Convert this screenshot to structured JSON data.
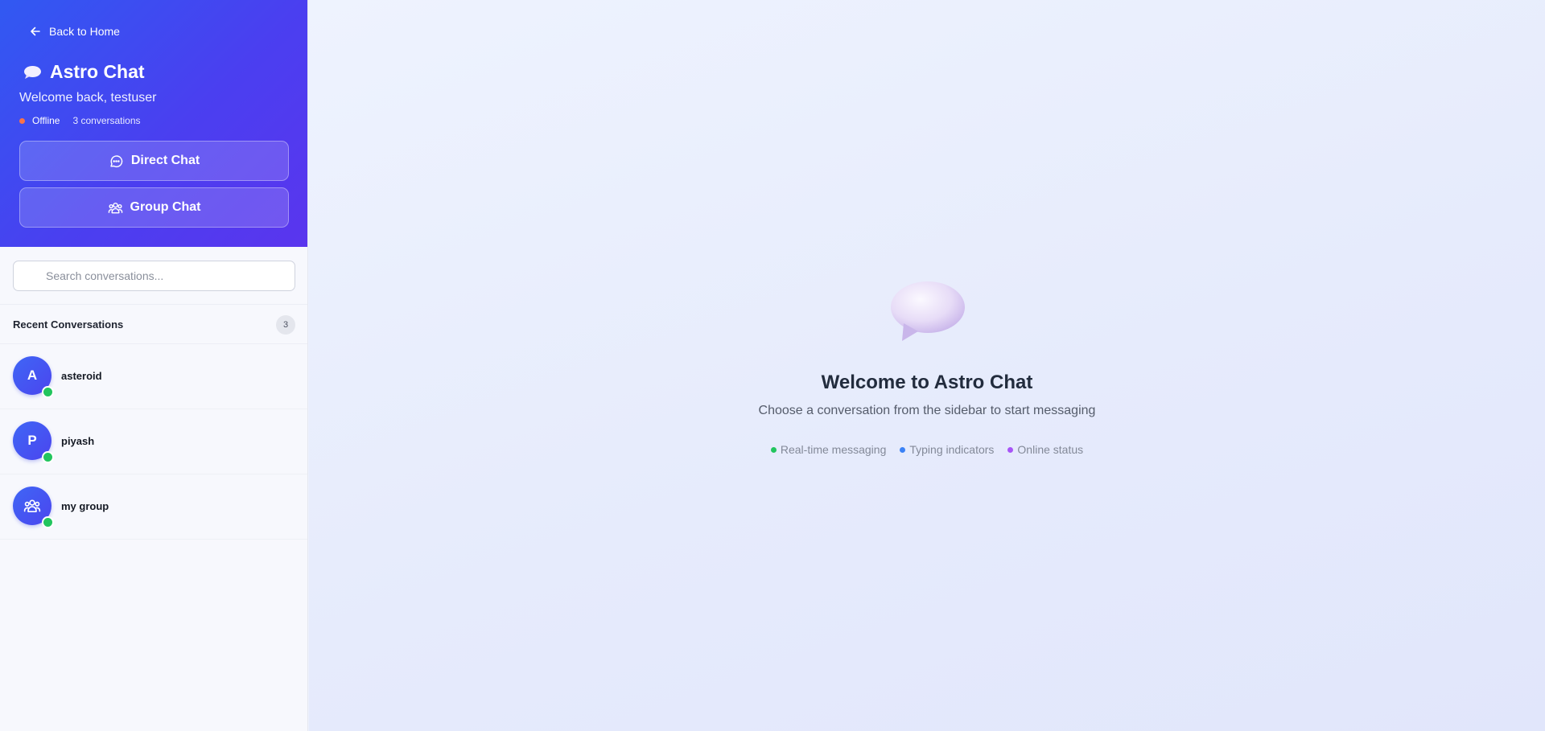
{
  "sidebar": {
    "back_label": "Back to Home",
    "app_title": "Astro Chat",
    "welcome_text": "Welcome back, testuser",
    "status": {
      "label": "Offline",
      "color": "#f97349"
    },
    "conversation_count_text": "3 conversations",
    "buttons": {
      "direct_chat": "Direct Chat",
      "group_chat": "Group Chat"
    },
    "search": {
      "placeholder": "Search conversations...",
      "value": ""
    },
    "recent": {
      "title": "Recent Conversations",
      "count": "3"
    },
    "conversations": [
      {
        "name": "asteroid",
        "avatar_letter": "A",
        "online": true
      },
      {
        "name": "piyash",
        "avatar_letter": "P",
        "online": true
      },
      {
        "name": "my group",
        "avatar_icon": "group-icon",
        "online": true
      }
    ]
  },
  "main": {
    "title": "Welcome to Astro Chat",
    "subtitle": "Choose a conversation from the sidebar to start messaging",
    "features": [
      {
        "label": "Real-time messaging",
        "color": "#22c55e"
      },
      {
        "label": "Typing indicators",
        "color": "#3b82f6"
      },
      {
        "label": "Online status",
        "color": "#a855f7"
      }
    ]
  },
  "theme": {
    "accent": "#4a3ff0",
    "header_gradient_start": "#3159f2",
    "online_color": "#22c55e"
  }
}
